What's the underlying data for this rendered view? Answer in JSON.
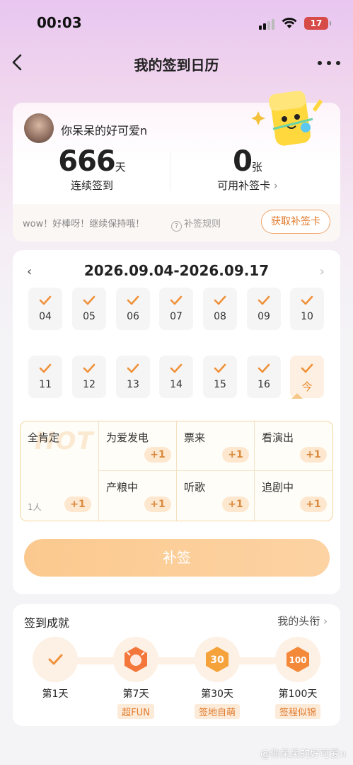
{
  "status_bar": {
    "time": "00:03",
    "battery": "17"
  },
  "nav": {
    "title": "我的签到日历"
  },
  "user": {
    "name": "你呆呆的好可爱n",
    "streak_value": "666",
    "streak_unit": "天",
    "streak_label": "连续签到",
    "cards_value": "0",
    "cards_unit": "张",
    "cards_label": "可用补签卡",
    "tip": "wow！好棒呀！继续保持哦！",
    "rule_label": "补签规则",
    "get_card_label": "获取补签卡"
  },
  "calendar": {
    "range": "2026.09.04-2026.09.17",
    "days": [
      "04",
      "05",
      "06",
      "07",
      "08",
      "09",
      "10",
      "11",
      "12",
      "13",
      "14",
      "15",
      "16",
      "今"
    ],
    "checked": [
      true,
      true,
      true,
      true,
      true,
      true,
      true,
      true,
      true,
      true,
      true,
      true,
      true,
      true
    ]
  },
  "tags": {
    "hot_text": "HOT",
    "primary": {
      "name": "全肯定",
      "count": "1人",
      "plus": "+1"
    },
    "items": [
      {
        "name": "为爱发电",
        "plus": "+1"
      },
      {
        "name": "票来",
        "plus": "+1"
      },
      {
        "name": "看演出",
        "plus": "+1"
      },
      {
        "name": "产粮中",
        "plus": "+1"
      },
      {
        "name": "听歌",
        "plus": "+1"
      },
      {
        "name": "追剧中",
        "plus": "+1"
      }
    ]
  },
  "supplement_button": "补签",
  "achievements": {
    "title": "签到成就",
    "link": "我的头衔",
    "items": [
      {
        "day": "第1天",
        "badge": ""
      },
      {
        "day": "第7天",
        "badge": "超FUN"
      },
      {
        "day": "第30天",
        "badge": "签地自萌"
      },
      {
        "day": "第100天",
        "badge": "签程似锦"
      }
    ]
  },
  "watermark": "@你呆呆的好可爱n",
  "colors": {
    "accent": "#f0913a",
    "accent_light": "#fde7cf",
    "button": "#fbc98f"
  }
}
